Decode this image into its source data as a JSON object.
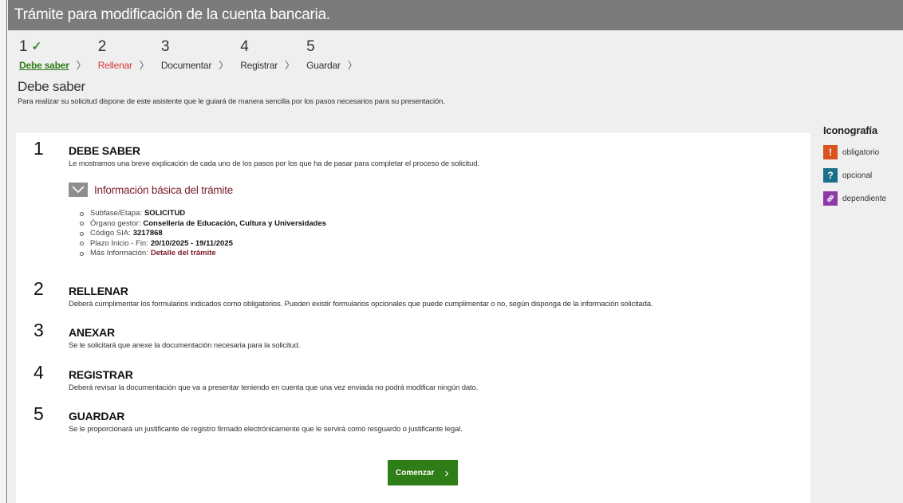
{
  "title": "Trámite para modificación de la cuenta bancaria.",
  "steps": [
    {
      "num": "1",
      "label": "Debe saber",
      "state": "done"
    },
    {
      "num": "2",
      "label": "Rellenar",
      "state": "current"
    },
    {
      "num": "3",
      "label": "Documentar",
      "state": "pending"
    },
    {
      "num": "4",
      "label": "Registrar",
      "state": "pending"
    },
    {
      "num": "5",
      "label": "Guardar",
      "state": "pending"
    }
  ],
  "section": {
    "heading": "Debe saber",
    "intro": "Para realizar su solicitud dispone de este asistente que le guiará de manera sencilla por los pasos necesarios para su presentación."
  },
  "blocks": [
    {
      "num": "1",
      "title": "DEBE SABER",
      "text": "Le mostramos una breve explicación de cada uno de los pasos por los que ha de pasar para completar el proceso de solicitud."
    },
    {
      "num": "2",
      "title": "RELLENAR",
      "text": "Deberá cumplimentar los formularios indicados como obligatorios. Pueden existir formularios opcionales que puede cumplimentar o no, según disponga de la información solicitada."
    },
    {
      "num": "3",
      "title": "ANEXAR",
      "text": "Se le solicitará que anexe la documentación necesaria para la solicitud."
    },
    {
      "num": "4",
      "title": "REGISTRAR",
      "text": "Deberá revisar la documentación que va a presentar teniendo en cuenta que una vez enviada no podrá modificar ningún dato."
    },
    {
      "num": "5",
      "title": "GUARDAR",
      "text": "Se le proporcionará un justificante de registro firmado electrónicamente que le servirá como resguardo o justificante legal."
    }
  ],
  "info": {
    "title": "Información básica del trámite",
    "items": [
      {
        "label": "Subfase/Etapa:",
        "value": "SOLICITUD"
      },
      {
        "label": "Órgano gestor:",
        "value": "Conselleria de Educación, Cultura y Universidades"
      },
      {
        "label": "Código SIA:",
        "value": "3217868"
      },
      {
        "label": "Plazo Inicio - Fin:",
        "value": "20/10/2025 - 19/11/2025"
      },
      {
        "label": "Más Información:",
        "value": "Detalle del trámite"
      }
    ]
  },
  "start_button": {
    "label": "Comenzar",
    "arrow": "›"
  },
  "legend": {
    "title": "Iconografía",
    "items": [
      {
        "label": "obligatorio",
        "glyph": "!",
        "color": "#d9531e"
      },
      {
        "label": "opcional",
        "glyph": "?",
        "color": "#1a6f8a"
      },
      {
        "label": "dependiente",
        "glyph": "🔗",
        "color": "#8e3aa6"
      }
    ]
  },
  "colors": {
    "accent_green": "#2e7d17",
    "current_red": "#d9343a",
    "info_maroon": "#7a1c2a",
    "title_bar": "#7b7b7b"
  }
}
